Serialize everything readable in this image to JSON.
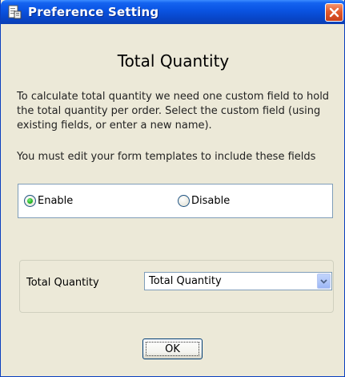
{
  "window": {
    "title": "Preference Setting"
  },
  "heading": "Total Quantity",
  "description": "To calculate total quantity we need one custom field to hold the total quantity per order. Select the custom field (using existing fields, or enter a new name).",
  "note": "You must edit your form templates to include these fields",
  "options": {
    "enable_label": "Enable",
    "disable_label": "Disable",
    "selected": "Enable"
  },
  "field": {
    "label": "Total Quantity",
    "value": "Total Quantity"
  },
  "buttons": {
    "ok_label": "OK"
  },
  "icons": {
    "title": "document-icon",
    "close": "close-icon",
    "dropdown": "chevron-down-icon"
  }
}
